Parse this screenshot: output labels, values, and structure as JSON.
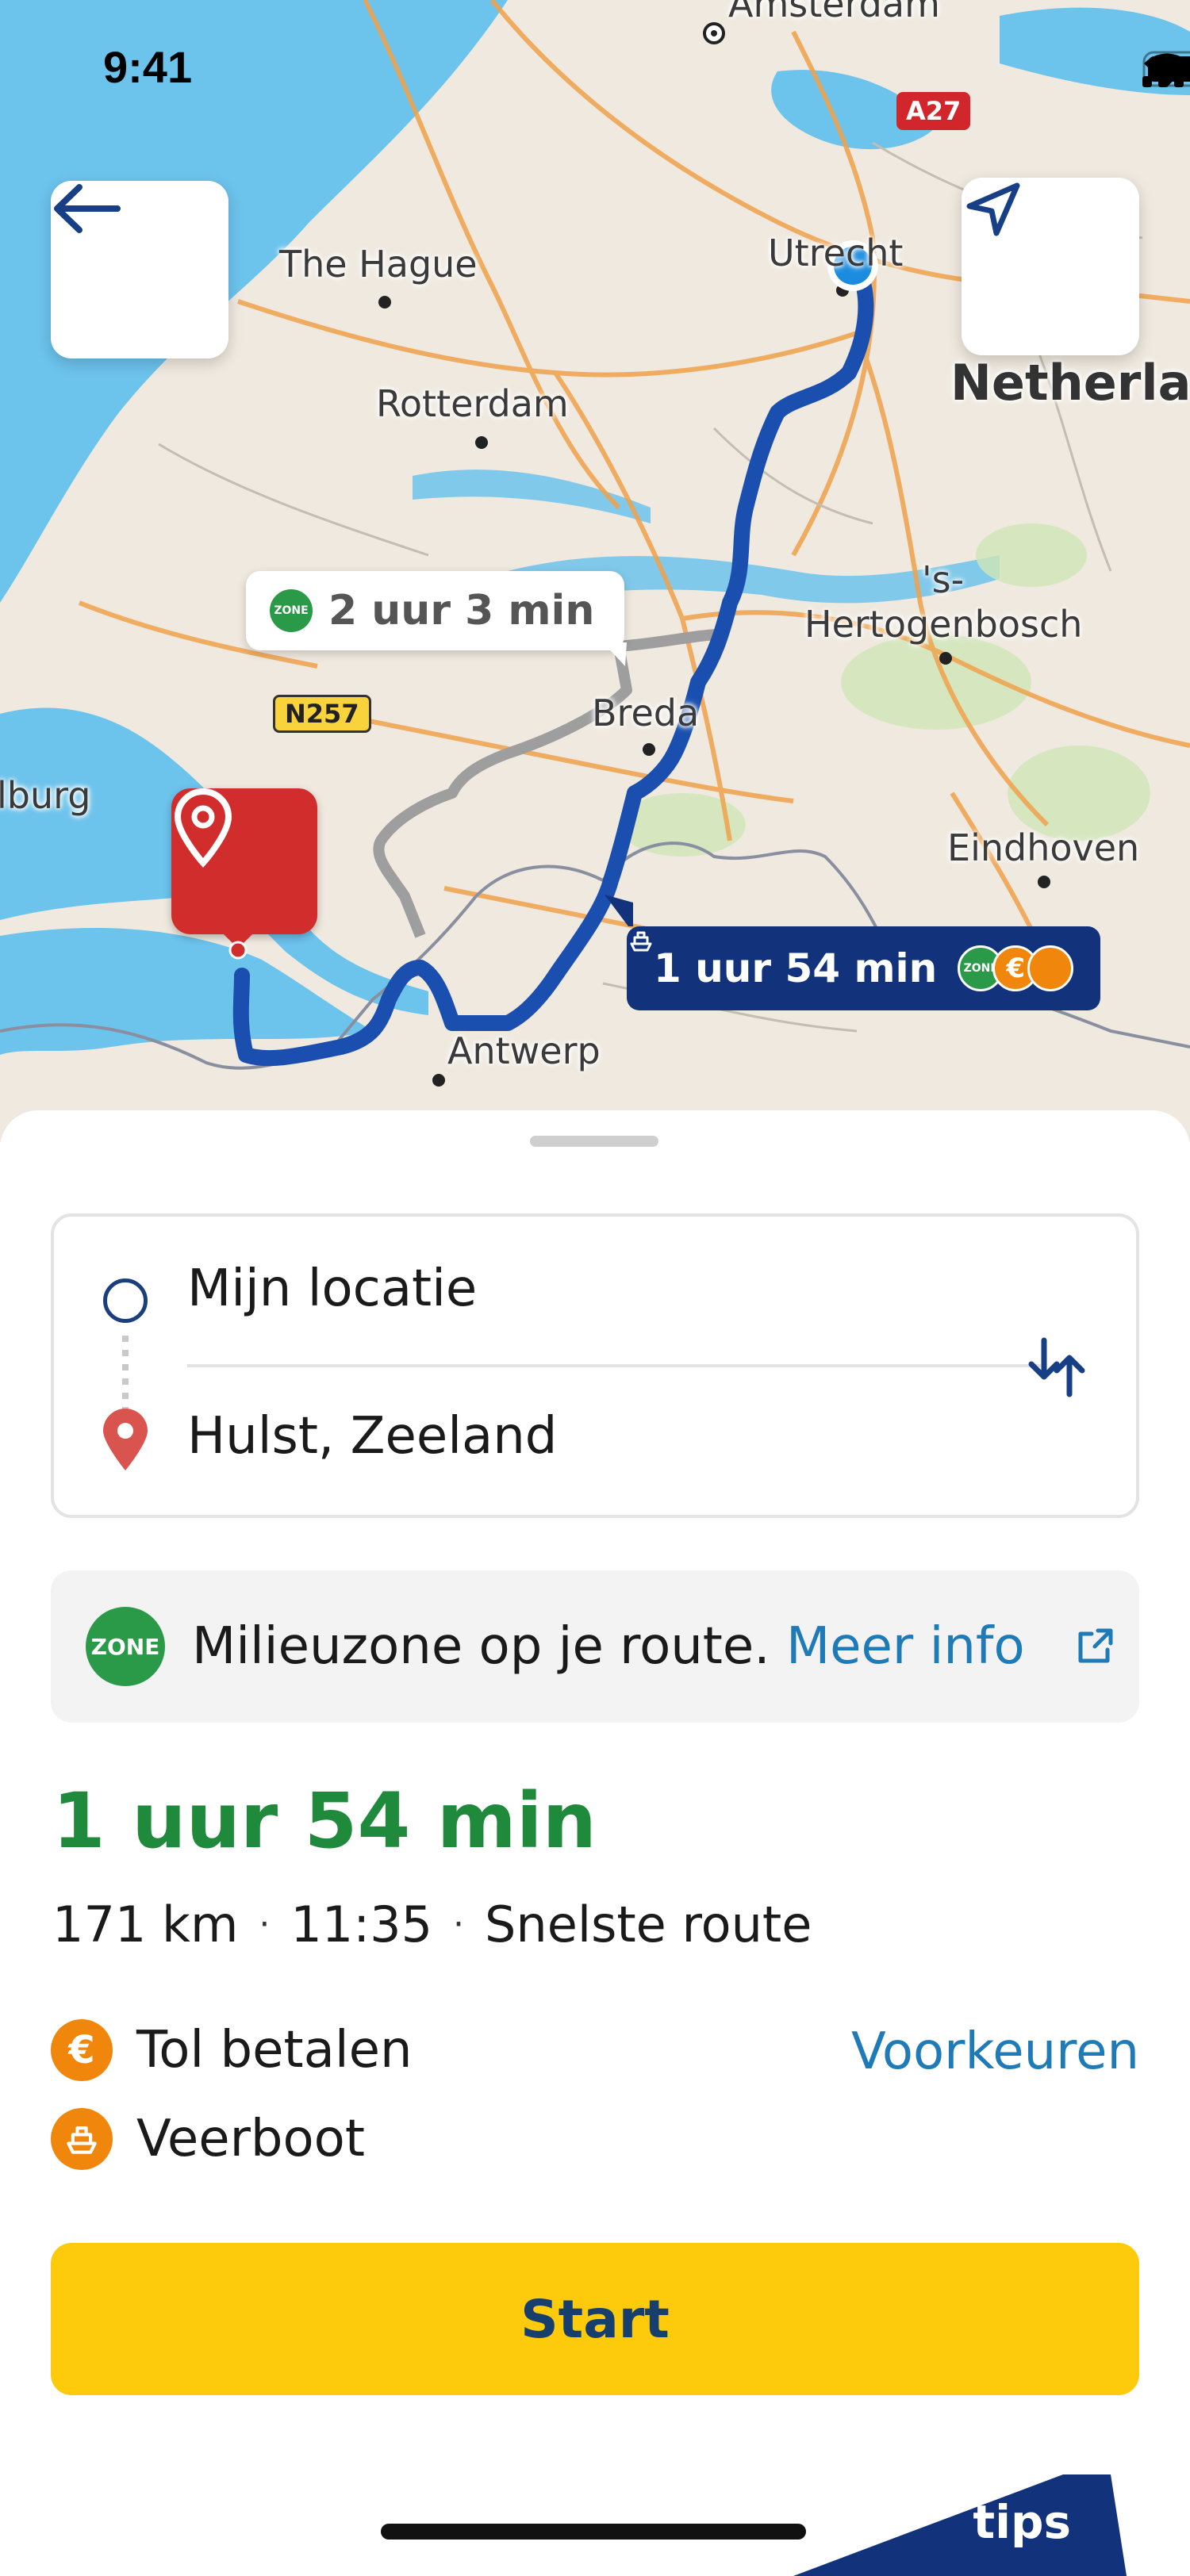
{
  "status_bar": {
    "time": "9:41"
  },
  "map": {
    "cities": {
      "amsterdam": "Amsterdam",
      "the_hague": "The Hague",
      "utrecht": "Utrecht",
      "netherlands": "Netherla",
      "rotterdam": "Rotterdam",
      "s_hertogenbosch": "'s-\nHertogenbosch",
      "breda": "Breda",
      "eindhoven": "Eindhoven",
      "antwerp": "Antwerp",
      "tilburg": "lburg"
    },
    "shields": {
      "a27": "A27",
      "n257": "N257"
    },
    "callout_alt": {
      "zone": "ZONE",
      "duration": "2 uur 3 min"
    },
    "callout_main": {
      "duration": "1 uur 54 min",
      "zone": "ZONE",
      "toll_symbol": "€",
      "ferry_icon": "ferry-icon"
    },
    "colors": {
      "route": "#1a4fb0",
      "alt_route": "#9e9e9e",
      "water": "#6cc3ec",
      "land": "#efe9df"
    }
  },
  "route_card": {
    "origin": "Mijn locatie",
    "destination": "Hulst, Zeeland"
  },
  "zone_banner": {
    "badge": "ZONE",
    "text": "Milieuzone op je route.",
    "link": "Meer info"
  },
  "summary": {
    "duration": "1 uur 54 min",
    "distance": "171 km",
    "arrival": "11:35",
    "type": "Snelste route",
    "separator": "·"
  },
  "features": [
    {
      "icon": "euro-icon",
      "symbol": "€",
      "label": "Tol betalen"
    },
    {
      "icon": "ferry-icon",
      "label": "Veerboot"
    }
  ],
  "preferences_link": "Voorkeuren",
  "start_button": "Start",
  "tips_label": "tips",
  "accent_colors": {
    "green": "#1f8a3b",
    "link_blue": "#1f7bb8",
    "start_yellow": "#fdcb0b",
    "orange": "#f0860c"
  }
}
